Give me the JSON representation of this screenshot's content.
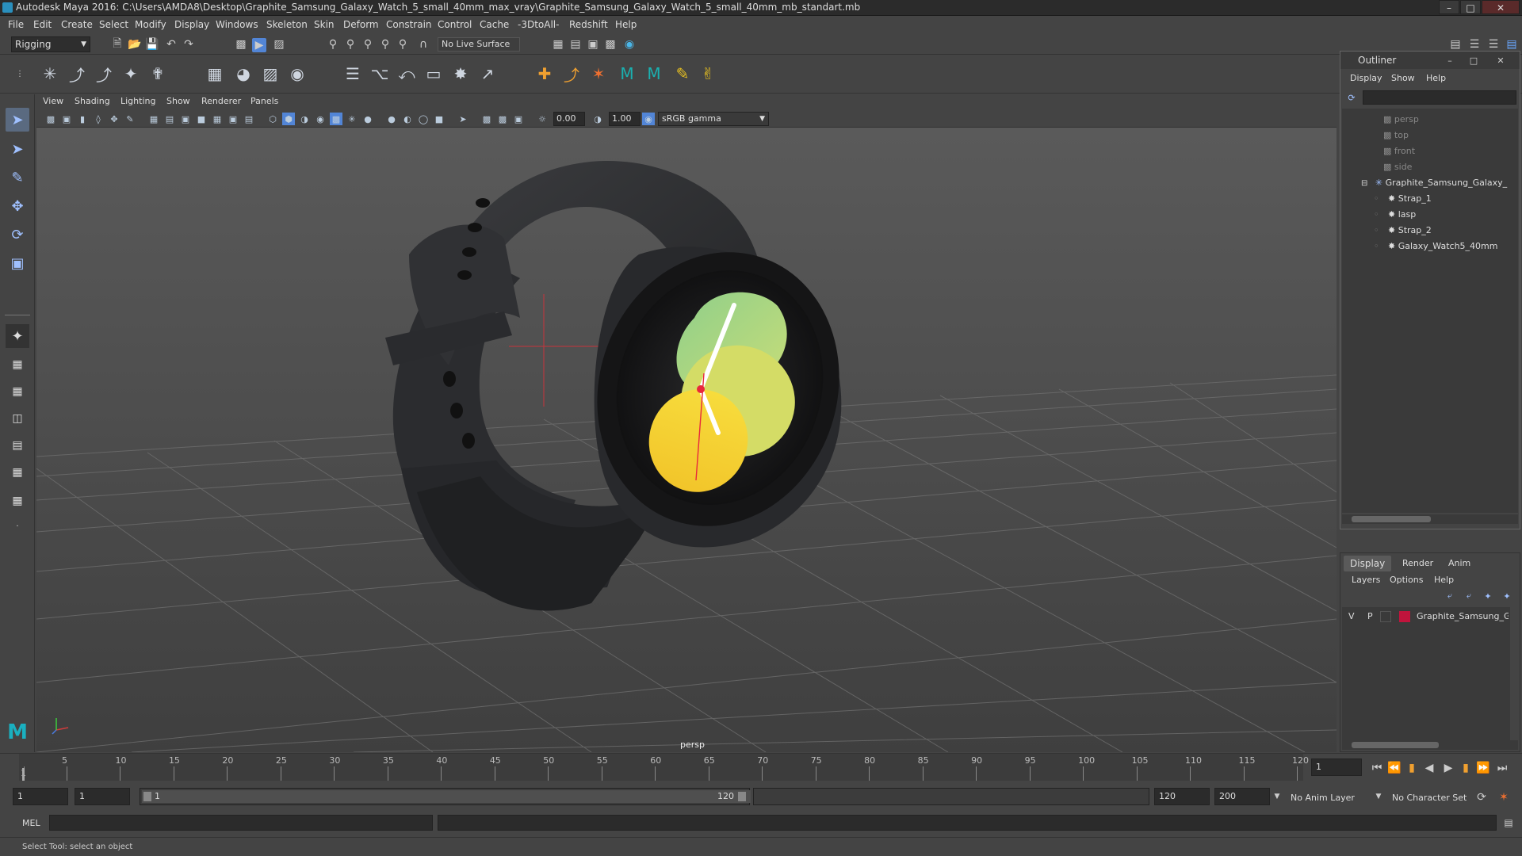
{
  "window": {
    "title": "Autodesk Maya 2016: C:\\Users\\AMDA8\\Desktop\\Graphite_Samsung_Galaxy_Watch_5_small_40mm_max_vray\\Graphite_Samsung_Galaxy_Watch_5_small_40mm_mb_standart.mb"
  },
  "menubar": [
    "File",
    "Edit",
    "Create",
    "Select",
    "Modify",
    "Display",
    "Windows",
    "Skeleton",
    "Skin",
    "Deform",
    "Constrain",
    "Control",
    "Cache",
    "-3DtoAll-",
    "Redshift",
    "Help"
  ],
  "statusline": {
    "mode": "Rigging",
    "live_surface": "No Live Surface"
  },
  "viewport": {
    "menu": [
      "View",
      "Shading",
      "Lighting",
      "Show",
      "Renderer",
      "Panels"
    ],
    "exposure": "0.00",
    "gamma": "1.00",
    "colorspace": "sRGB gamma",
    "camera_label": "persp"
  },
  "outliner": {
    "title": "Outliner",
    "menu": [
      "Display",
      "Show",
      "Help"
    ],
    "items": [
      {
        "label": "persp",
        "kind": "camera",
        "indent": 0
      },
      {
        "label": "top",
        "kind": "camera",
        "indent": 0
      },
      {
        "label": "front",
        "kind": "camera",
        "indent": 0
      },
      {
        "label": "side",
        "kind": "camera",
        "indent": 0
      },
      {
        "label": "Graphite_Samsung_Galaxy_",
        "kind": "group",
        "indent": 0
      },
      {
        "label": "Strap_1",
        "kind": "mesh",
        "indent": 1
      },
      {
        "label": "lasp",
        "kind": "mesh",
        "indent": 1
      },
      {
        "label": "Strap_2",
        "kind": "mesh",
        "indent": 1
      },
      {
        "label": "Galaxy_Watch5_40mm",
        "kind": "mesh",
        "indent": 1
      }
    ]
  },
  "layers": {
    "tabs": [
      "Display",
      "Render",
      "Anim"
    ],
    "menu": [
      "Layers",
      "Options",
      "Help"
    ],
    "row": {
      "v": "V",
      "p": "P",
      "name": "Graphite_Samsung_Gala",
      "color": "#c0143c"
    }
  },
  "timeline": {
    "ticks": [
      "1",
      "5",
      "10",
      "15",
      "20",
      "25",
      "30",
      "35",
      "40",
      "45",
      "50",
      "55",
      "60",
      "65",
      "70",
      "75",
      "80",
      "85",
      "90",
      "95",
      "100",
      "105",
      "110",
      "115",
      "120"
    ],
    "current_frame": "1"
  },
  "range": {
    "start": "1",
    "current": "1",
    "slider_start": "1",
    "slider_end": "120",
    "end": "120",
    "max": "200",
    "anim_layer": "No Anim Layer",
    "char_set": "No Character Set"
  },
  "cmd": {
    "label": "MEL"
  },
  "help": {
    "text": "Select Tool: select an object"
  },
  "colors": {
    "accent": "#5285d6",
    "layer": "#c0143c",
    "face_green": "#a8d47a",
    "face_yellow": "#f4d63a"
  }
}
